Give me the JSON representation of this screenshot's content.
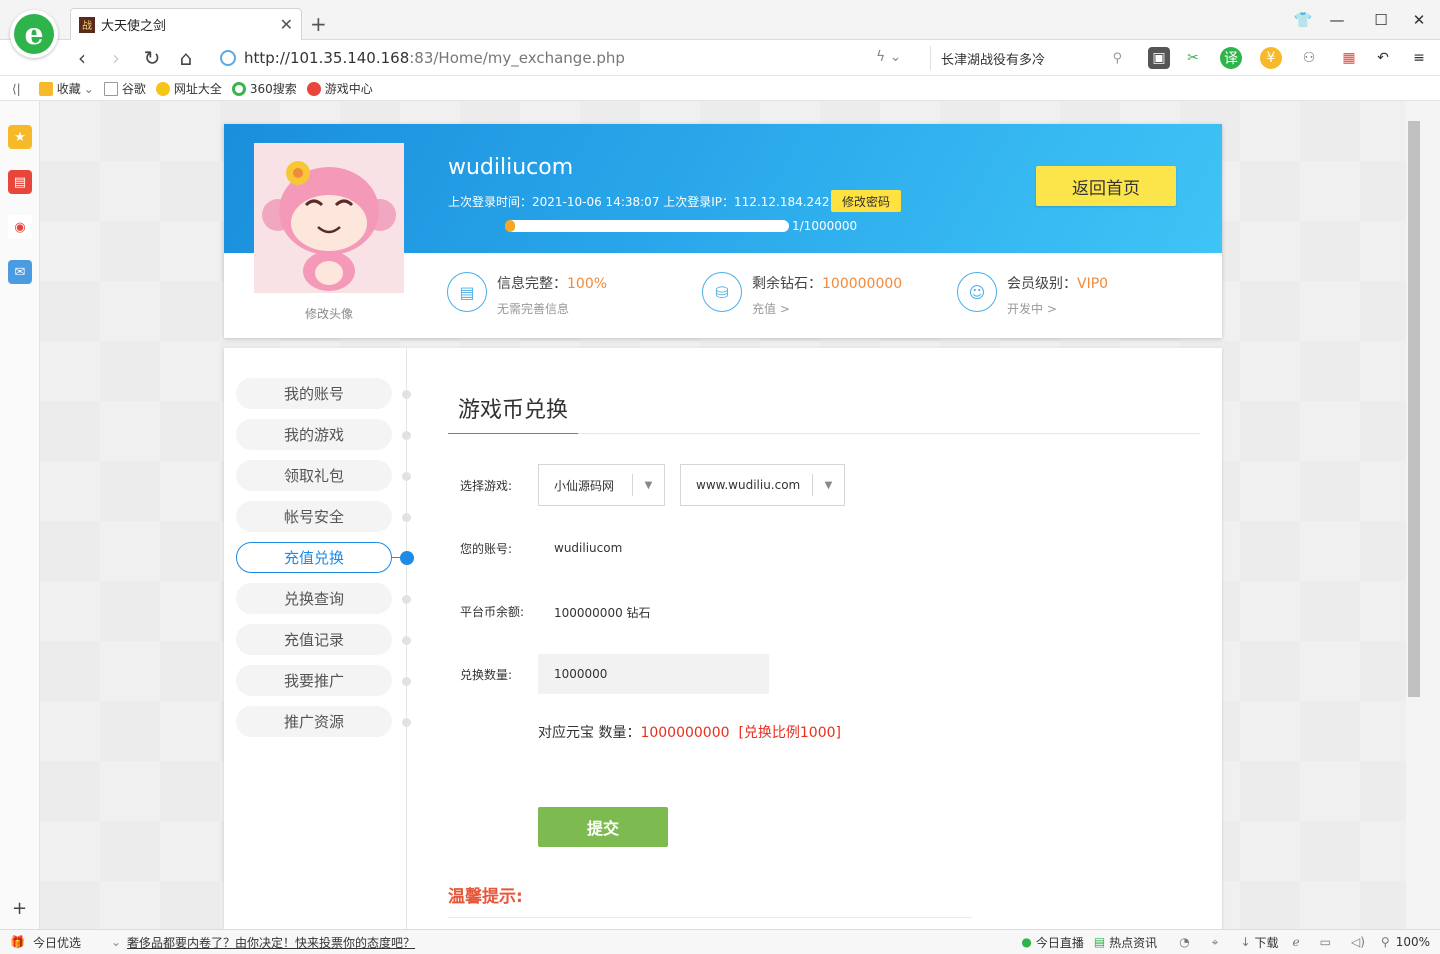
{
  "browser": {
    "tab_title": "大天使之剑",
    "tab_favicon": "战",
    "url_host": "http://101.35.140.168",
    "url_rest": ":83/Home/my_exchange.php",
    "search_text": "长津湖战役有多冷",
    "bookmarks": [
      "收藏",
      "谷歌",
      "网址大全",
      "360搜索",
      "游戏中心"
    ]
  },
  "profile": {
    "username": "wudiliucom",
    "login_info": "上次登录时间：2021-10-06 14:38:07 上次登录IP：112.12.184.242",
    "change_password": "修改密码",
    "progress_value": 1,
    "progress_max": 1000000,
    "progress_text": "1/1000000",
    "home_button": "返回首页",
    "avatar_label": "修改头像",
    "stats": [
      {
        "label": "信息完整：",
        "value": "100%",
        "sub": "无需完善信息"
      },
      {
        "label": "剩余钻石：",
        "value": "100000000",
        "sub": "充值 >"
      },
      {
        "label": "会员级别：",
        "value": "VIP0",
        "sub": "开发中 >"
      }
    ]
  },
  "menu": [
    "我的账号",
    "我的游戏",
    "领取礼包",
    "帐号安全",
    "充值兑换",
    "兑换查询",
    "充值记录",
    "我要推广",
    "推广资源"
  ],
  "active_menu_index": 4,
  "exchange": {
    "title": "游戏币兑换",
    "game_label": "选择游戏:",
    "game_select": "小仙源码网",
    "server_select": "www.wudiliu.com",
    "account_label": "您的账号:",
    "account_value": "wudiliucom",
    "balance_label": "平台币余额:",
    "balance_value": "100000000 钻石",
    "qty_label": "兑换数量:",
    "qty_value": "1000000",
    "result_prefix": "对应元宝 数量：",
    "result_value": "1000000000",
    "result_ratio": "[兑换比例1000]",
    "submit": "提交",
    "tips_title": "温馨提示:"
  },
  "statusbar": {
    "left_label": "今日优选",
    "news": "奢侈品都要内卷了？由你决定！快来投票你的态度吧？",
    "live": "今日直播",
    "hot": "热点资讯",
    "download": "下载",
    "zoom": "100%"
  },
  "colors": {
    "accent_blue": "#1e8be6",
    "submit_green": "#7dbb50",
    "highlight_red": "#e82e1e",
    "yellow": "#fbe54a"
  }
}
